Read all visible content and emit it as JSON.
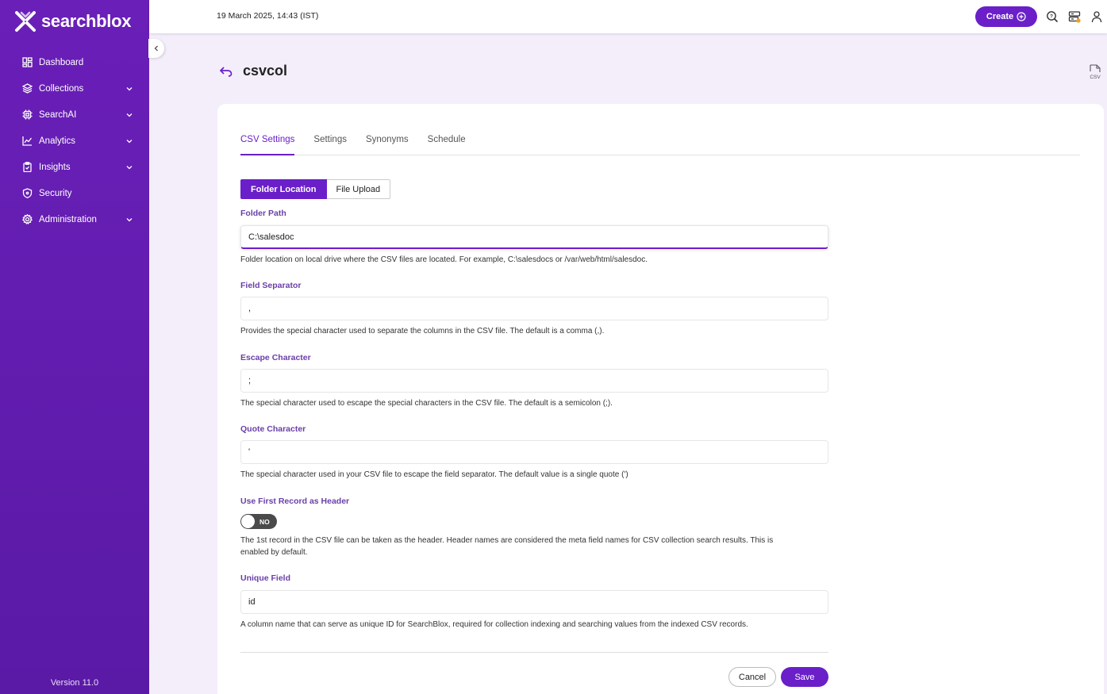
{
  "app": {
    "brand": "searchblox",
    "version": "Version 11.0"
  },
  "sidebar": {
    "items": [
      {
        "label": "Dashboard",
        "icon": "dashboard-icon",
        "expandable": false
      },
      {
        "label": "Collections",
        "icon": "layers-icon",
        "expandable": true
      },
      {
        "label": "SearchAI",
        "icon": "chip-icon",
        "expandable": true
      },
      {
        "label": "Analytics",
        "icon": "analytics-icon",
        "expandable": true
      },
      {
        "label": "Insights",
        "icon": "clipboard-icon",
        "expandable": true
      },
      {
        "label": "Security",
        "icon": "shield-icon",
        "expandable": false
      },
      {
        "label": "Administration",
        "icon": "gear-icon",
        "expandable": true
      }
    ]
  },
  "topbar": {
    "datetime": "19 March 2025, 14:43 (IST)",
    "create_label": "Create"
  },
  "page": {
    "title": "csvcol"
  },
  "tabs": [
    {
      "label": "CSV Settings",
      "active": true
    },
    {
      "label": "Settings",
      "active": false
    },
    {
      "label": "Synonyms",
      "active": false
    },
    {
      "label": "Schedule",
      "active": false
    }
  ],
  "source": {
    "folder_label": "Folder Location",
    "upload_label": "File Upload"
  },
  "form": {
    "folder_path": {
      "label": "Folder Path",
      "value": "C:\\salesdoc",
      "help": "Folder location on local drive where the CSV files are located. For example, C:\\salesdocs or /var/web/html/salesdoc."
    },
    "field_separator": {
      "label": "Field Separator",
      "value": ",",
      "help": "Provides the special character used to separate the columns in the CSV file. The default is a comma (,)."
    },
    "escape_character": {
      "label": "Escape Character",
      "value": ";",
      "help": "The special character used to escape the special characters in the CSV file. The default is a semicolon (;)."
    },
    "quote_character": {
      "label": "Quote Character",
      "value": "'",
      "help": "The special character used in your CSV file to escape the field separator. The default value is a single quote (')"
    },
    "use_header": {
      "label": "Use First Record as Header",
      "toggle_text": "NO",
      "help": "The 1st record in the CSV file can be taken as the header. Header names are considered the meta field names for CSV collection search results. This is enabled by default."
    },
    "unique_field": {
      "label": "Unique Field",
      "value": "id",
      "help": "A column name that can serve as unique ID for SearchBlox, required for collection indexing and searching values from the indexed CSV records."
    }
  },
  "actions": {
    "cancel_label": "Cancel",
    "save_label": "Save"
  },
  "colors": {
    "accent": "#6a1fc9",
    "sidebar": "#6a1fb8",
    "label": "#6a3fa8"
  }
}
